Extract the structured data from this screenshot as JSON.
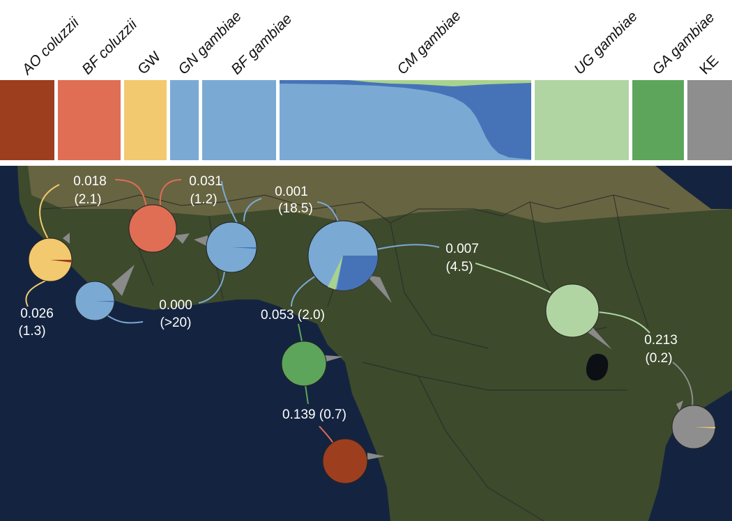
{
  "colors": {
    "ao": "#9d3e1f",
    "bf_coluzzii": "#e06e54",
    "gw": "#f2c96e",
    "gambiae_light_blue": "#7aaad4",
    "gambiae_dark_blue": "#4673b8",
    "ug": "#b1d5a2",
    "ga": "#5ea55c",
    "ke": "#8e8e8e",
    "light_green_mix": "#a8d38e",
    "land": "#3d4a2c",
    "ocean": "#142440"
  },
  "admixture": {
    "populations": [
      {
        "label": "AO coluzzii",
        "color": "ao"
      },
      {
        "label": "BF coluzzii",
        "color": "bf_coluzzii"
      },
      {
        "label": "GW",
        "color": "gw"
      },
      {
        "label": "GN gambiae",
        "color": "gambiae_light_blue"
      },
      {
        "label": "BF gambiae",
        "color": "gambiae_light_blue"
      },
      {
        "label": "CM gambiae",
        "color": "gambiae_light_blue"
      },
      {
        "label": "UG gambiae",
        "color": "ug"
      },
      {
        "label": "GA gambiae",
        "color": "ga"
      },
      {
        "label": "KE",
        "color": "ke"
      }
    ]
  },
  "map": {
    "sites": [
      {
        "population": "GW",
        "stat": "0.026",
        "ratio": "(1.3)",
        "fill": "gw",
        "slice": {
          "fraction": 0.02,
          "color": "ao"
        }
      },
      {
        "population": "GN gambiae",
        "stat": "0.000",
        "ratio": "(>20)",
        "fill": "gambiae_light_blue",
        "slice": {
          "fraction": 0.01,
          "color": "gambiae_dark_blue"
        }
      },
      {
        "population": "BF coluzzii",
        "stat": "0.018",
        "ratio": "(2.1)",
        "fill": "bf_coluzzii",
        "slice": null
      },
      {
        "population": "BF gambiae",
        "stat": "0.031",
        "ratio": "(1.2)",
        "fill": "gambiae_light_blue",
        "slice": {
          "fraction": 0.01,
          "color": "gambiae_dark_blue"
        }
      },
      {
        "population": "CM gambiae",
        "stat": "0.001",
        "ratio": "(18.5)",
        "fill": "gambiae_light_blue",
        "slice": {
          "fraction": 0.28,
          "color": "gambiae_dark_blue"
        }
      },
      {
        "population": "GA gambiae",
        "stat": "0.053 (2.0)",
        "ratio": "",
        "fill": "ga",
        "slice": null
      },
      {
        "population": "AO coluzzii",
        "stat": "0.139 (0.7)",
        "ratio": "",
        "fill": "ao",
        "slice": null
      },
      {
        "population": "UG gambiae",
        "stat": "0.007",
        "ratio": "(4.5)",
        "fill": "ug",
        "slice": null
      },
      {
        "population": "KE",
        "stat": "0.213",
        "ratio": "(0.2)",
        "fill": "ke",
        "slice": {
          "fraction": 0.01,
          "color": "gw"
        }
      }
    ]
  }
}
